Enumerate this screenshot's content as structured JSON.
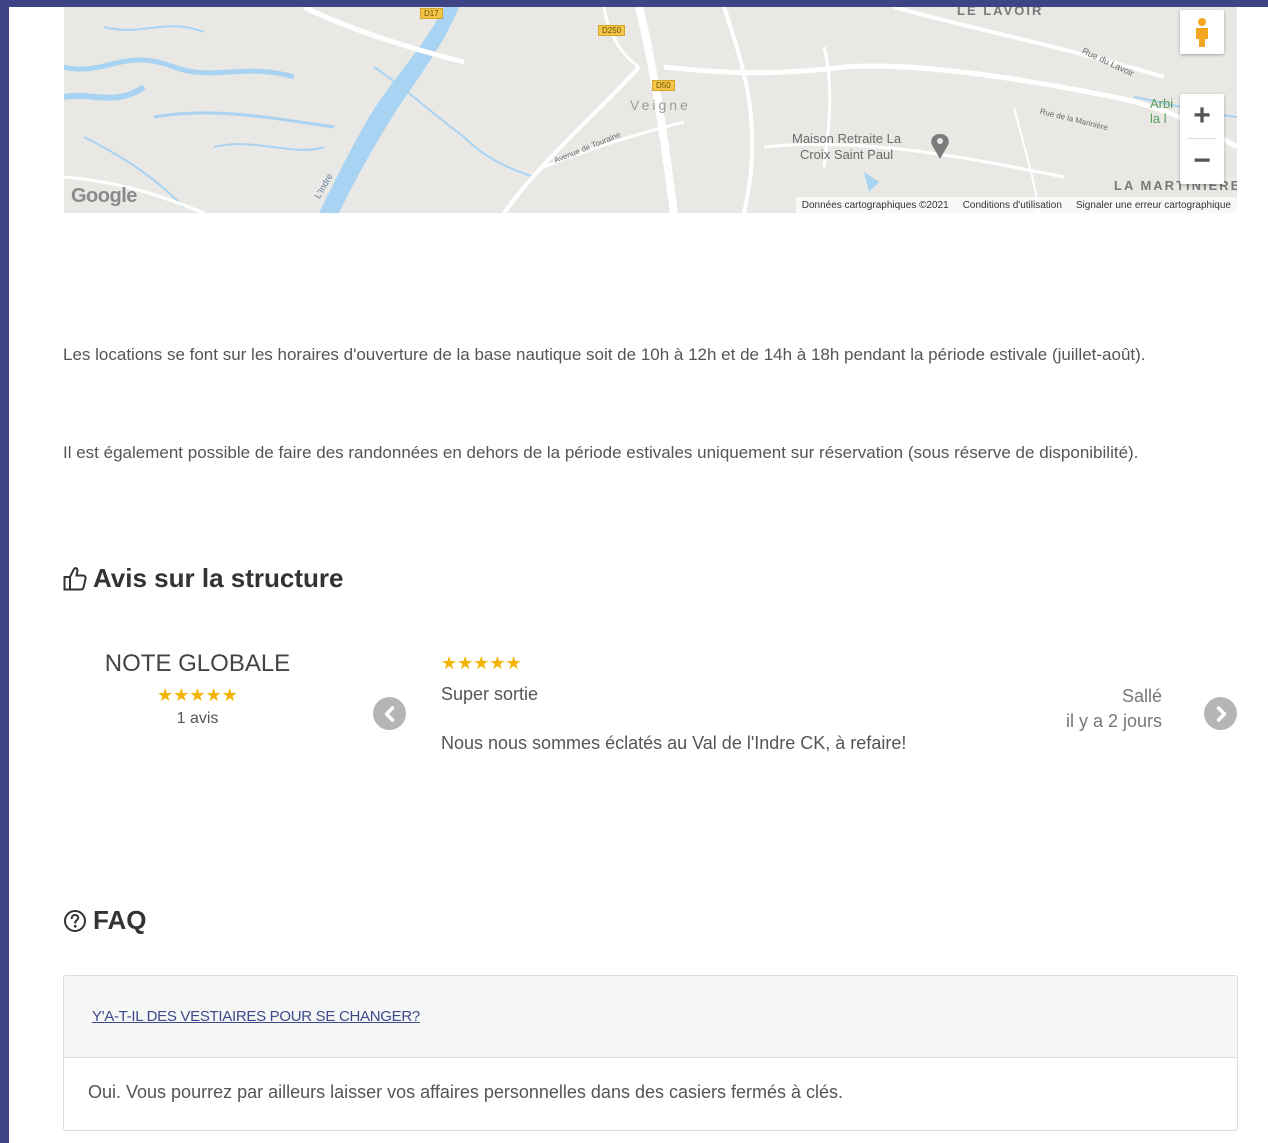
{
  "map": {
    "labels": {
      "le_lavoir": "LE LAVOIR",
      "veigne": "Veigne",
      "maison_retraite": "Maison Retraite La\nCroix Saint Paul",
      "rue_du_lavoir": "Rue du Lavoir",
      "rue_marinieres": "Rue de la Marinière",
      "avenue_touraine": "Avenue de Touraine",
      "la_martiniere": "LA MARTINIÈRE",
      "arbre_partial": "Arbi\nla l",
      "indre": "L'Indre",
      "road_d17": "D17",
      "road_d250": "D250",
      "road_d50": "D50"
    },
    "google_logo": "Google",
    "footer": {
      "data": "Données cartographiques ©2021",
      "terms": "Conditions d'utilisation",
      "report": "Signaler une erreur cartographique"
    },
    "zoom_in": "+",
    "zoom_out": "−"
  },
  "content": {
    "para1": "Les locations se font sur les horaires d'ouverture de la base nautique soit de 10h à 12h et de 14h à 18h pendant la période estivale (juillet-août).",
    "para2": "Il est également possible de faire des randonnées en dehors de la période estivales uniquement sur réservation (sous réserve de disponibilité)."
  },
  "reviews_section": {
    "title": "Avis sur la structure",
    "note_globale": "NOTE GLOBALE",
    "overall_stars": "★★★★★",
    "count": "1 avis",
    "review": {
      "stars": "★★★★★",
      "title": "Super sortie",
      "text": "Nous nous sommes éclatés au Val de l'Indre CK, à refaire!",
      "author": "Sallé",
      "date": "il y a 2 jours"
    }
  },
  "faq": {
    "title": "FAQ",
    "items": [
      {
        "question": "Y'A-T-IL DES VESTIAIRES POUR SE CHANGER?",
        "answer": "Oui. Vous pourrez par ailleurs laisser vos affaires personnelles dans des casiers fermés à clés."
      }
    ]
  },
  "colors": {
    "frame": "#3f4486",
    "star": "#f5b301",
    "link": "#3c4a8a"
  }
}
